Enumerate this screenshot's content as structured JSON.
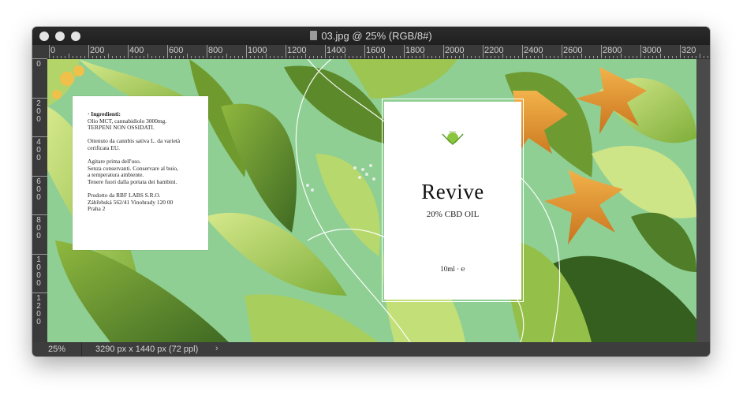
{
  "window": {
    "title": "03.jpg @ 25% (RGB/8#)"
  },
  "ruler": {
    "horizontal": [
      "0",
      "200",
      "400",
      "600",
      "800",
      "1000",
      "1200",
      "1400",
      "1600",
      "1800",
      "2000",
      "2200",
      "2400",
      "2600",
      "2800",
      "3000",
      "320"
    ],
    "vertical": [
      [
        "0"
      ],
      [
        "2",
        "0",
        "0"
      ],
      [
        "4",
        "0",
        "0"
      ],
      [
        "6",
        "0",
        "0"
      ],
      [
        "8",
        "0",
        "0"
      ],
      [
        "1",
        "0",
        "0",
        "0"
      ],
      [
        "1",
        "2",
        "0",
        "0"
      ]
    ]
  },
  "status": {
    "zoom": "25%",
    "doc_size": "3290 px x 1440 px (72 ppl)",
    "arrow": "›"
  },
  "back_label": {
    "heading": "· Ingredienti:",
    "body": "Olio MCT, cannabidiolo 3000mg.\nTERPENI NON OSSIDATI.\n\nOttenuto da cannbis sativa L. da varietà\ncerificata EU.\n\nAgitare prima dell'uso.\nSenza conservanti. Conservare al buio,\na temperatura ambiente.\nTenere fuori dalla portata dei bambini.\n\nProdotto da RBF LABS S.R.O.\nZáhřebská 562/41 Vinohrady 120 00\nPraha 2"
  },
  "front_label": {
    "logo_text": "Revive",
    "brand": "Revive",
    "subtitle": "20% CBD OIL",
    "volume": "10ml · ℮"
  },
  "colors": {
    "canvas_bg": "#8fcf94",
    "leaf_light": "#b8d86a",
    "leaf_dark": "#4f7d28",
    "flower": "#e59a2f"
  }
}
